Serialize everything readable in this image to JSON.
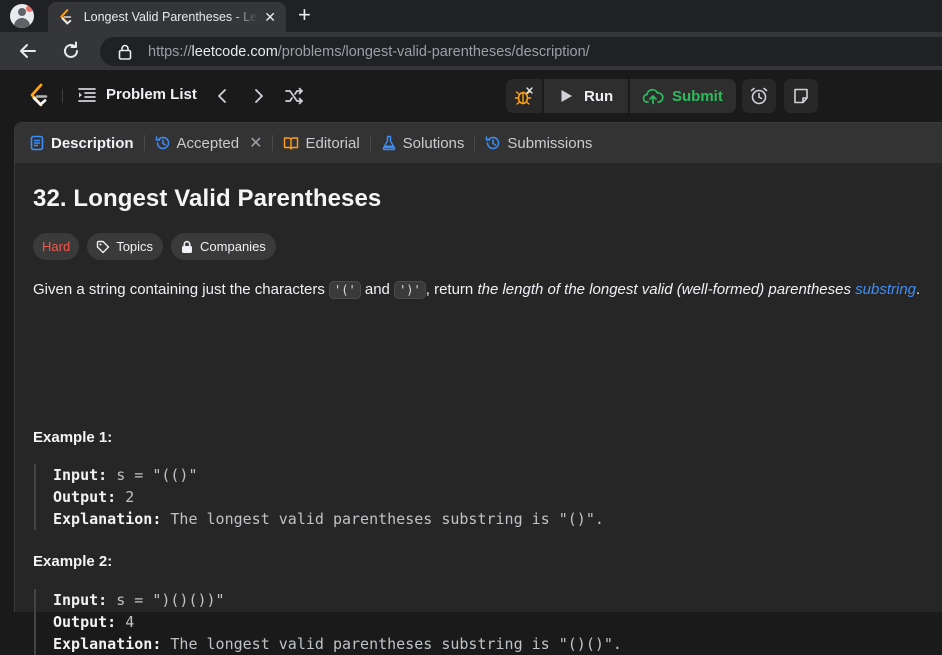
{
  "browser": {
    "tab_title": "Longest Valid Parentheses - LeetCode",
    "url_prefix": "https://",
    "url_host": "leetcode.com",
    "url_path": "/problems/longest-valid-parentheses/description/"
  },
  "topbar": {
    "problem_list_label": "Problem List",
    "run_label": "Run",
    "submit_label": "Submit"
  },
  "panel_tabs": {
    "description": "Description",
    "accepted": "Accepted",
    "editorial": "Editorial",
    "solutions": "Solutions",
    "submissions": "Submissions"
  },
  "problem": {
    "title": "32. Longest Valid Parentheses",
    "difficulty": "Hard",
    "topics_label": "Topics",
    "companies_label": "Companies",
    "statement_part1": "Given a string containing just the characters ",
    "code_open": "'('",
    "statement_and": " and ",
    "code_close": "')'",
    "statement_part2": ", return ",
    "statement_italic": "the length of the longest valid (well-formed) parentheses ",
    "statement_link": "substring",
    "statement_end": "."
  },
  "examples": [
    {
      "heading": "Example 1:",
      "input_key": "Input:",
      "input_value": " s = \"(()\"",
      "output_key": "Output:",
      "output_value": " 2",
      "explanation_key": "Explanation:",
      "explanation_value": " The longest valid parentheses substring is \"()\"."
    },
    {
      "heading": "Example 2:",
      "input_key": "Input:",
      "input_value": " s = \")()())\"",
      "output_key": "Output:",
      "output_value": " 4",
      "explanation_key": "Explanation:",
      "explanation_value": " The longest valid parentheses substring is \"()()\"."
    }
  ],
  "colors": {
    "accent_green": "#2cbb5d",
    "hard_red": "#f0584b",
    "link_blue": "#3d8ef8",
    "leetcode_orange": "#ffa116"
  }
}
